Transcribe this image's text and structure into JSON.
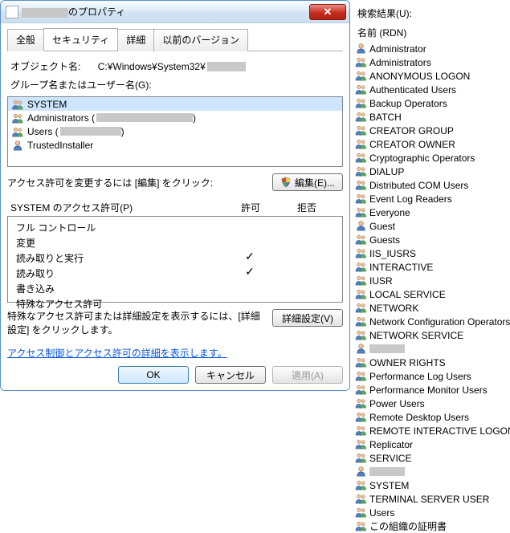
{
  "dialog": {
    "title_suffix": "のプロパティ",
    "close_glyph": "✕",
    "tabs": [
      "全般",
      "セキュリティ",
      "詳細",
      "以前のバージョン"
    ],
    "active_tab_index": 1,
    "object_label": "オブジェクト名:",
    "object_path": "C:¥Windows¥System32¥",
    "groups_label": "グループ名またはユーザー名(G):",
    "principals": [
      {
        "name": "SYSTEM",
        "extra": "",
        "redact_w": 0,
        "sel": true,
        "icon": "group"
      },
      {
        "name": "Administrators (",
        "extra": ")",
        "redact_w": 120,
        "sel": false,
        "icon": "group"
      },
      {
        "name": "Users (",
        "extra": ")",
        "redact_w": 76,
        "sel": false,
        "icon": "group"
      },
      {
        "name": "TrustedInstaller",
        "extra": "",
        "redact_w": 0,
        "sel": false,
        "icon": "user"
      }
    ],
    "edit_hint": "アクセス許可を変更するには [編集] をクリック:",
    "edit_btn": "編集(E)...",
    "perm_header_label": "SYSTEM のアクセス許可(P)",
    "perm_allow": "許可",
    "perm_deny": "拒否",
    "permissions": [
      {
        "name": "フル コントロール",
        "allow": "",
        "deny": ""
      },
      {
        "name": "変更",
        "allow": "",
        "deny": ""
      },
      {
        "name": "読み取りと実行",
        "allow": "✓",
        "deny": ""
      },
      {
        "name": "読み取り",
        "allow": "✓",
        "deny": ""
      },
      {
        "name": "書き込み",
        "allow": "",
        "deny": ""
      },
      {
        "name": "特殊なアクセス許可",
        "allow": "",
        "deny": ""
      }
    ],
    "advanced_hint": "特殊なアクセス許可または詳細設定を表示するには、[詳細設定] をクリックします。",
    "advanced_btn": "詳細設定(V)",
    "help_link": "アクセス制御とアクセス許可の詳細を表示します。",
    "ok": "OK",
    "cancel": "キャンセル",
    "apply": "適用(A)"
  },
  "right": {
    "header": "検索結果(U):",
    "subheader": "名前 (RDN)",
    "items": [
      {
        "name": "Administrator",
        "icon": "user"
      },
      {
        "name": "Administrators",
        "icon": "group"
      },
      {
        "name": "ANONYMOUS LOGON",
        "icon": "group"
      },
      {
        "name": "Authenticated Users",
        "icon": "group"
      },
      {
        "name": "Backup Operators",
        "icon": "group"
      },
      {
        "name": "BATCH",
        "icon": "group"
      },
      {
        "name": "CREATOR GROUP",
        "icon": "group"
      },
      {
        "name": "CREATOR OWNER",
        "icon": "group"
      },
      {
        "name": "Cryptographic Operators",
        "icon": "group"
      },
      {
        "name": "DIALUP",
        "icon": "group"
      },
      {
        "name": "Distributed COM Users",
        "icon": "group"
      },
      {
        "name": "Event Log Readers",
        "icon": "group"
      },
      {
        "name": "Everyone",
        "icon": "group"
      },
      {
        "name": "Guest",
        "icon": "user"
      },
      {
        "name": "Guests",
        "icon": "group"
      },
      {
        "name": "IIS_IUSRS",
        "icon": "group"
      },
      {
        "name": "INTERACTIVE",
        "icon": "group"
      },
      {
        "name": "IUSR",
        "icon": "group"
      },
      {
        "name": "LOCAL SERVICE",
        "icon": "group"
      },
      {
        "name": "NETWORK",
        "icon": "group"
      },
      {
        "name": "Network Configuration Operators",
        "icon": "group"
      },
      {
        "name": "NETWORK SERVICE",
        "icon": "group"
      },
      {
        "name": "",
        "icon": "user",
        "redact": true
      },
      {
        "name": "OWNER RIGHTS",
        "icon": "group"
      },
      {
        "name": "Performance Log Users",
        "icon": "group"
      },
      {
        "name": "Performance Monitor Users",
        "icon": "group"
      },
      {
        "name": "Power Users",
        "icon": "group"
      },
      {
        "name": "Remote Desktop Users",
        "icon": "group"
      },
      {
        "name": "REMOTE INTERACTIVE LOGON",
        "icon": "group"
      },
      {
        "name": "Replicator",
        "icon": "group"
      },
      {
        "name": "SERVICE",
        "icon": "group"
      },
      {
        "name": "",
        "icon": "user",
        "redact": true
      },
      {
        "name": "SYSTEM",
        "icon": "group"
      },
      {
        "name": "TERMINAL SERVER USER",
        "icon": "group"
      },
      {
        "name": "Users",
        "icon": "group"
      },
      {
        "name": "この組織の証明書",
        "icon": "group"
      }
    ]
  }
}
